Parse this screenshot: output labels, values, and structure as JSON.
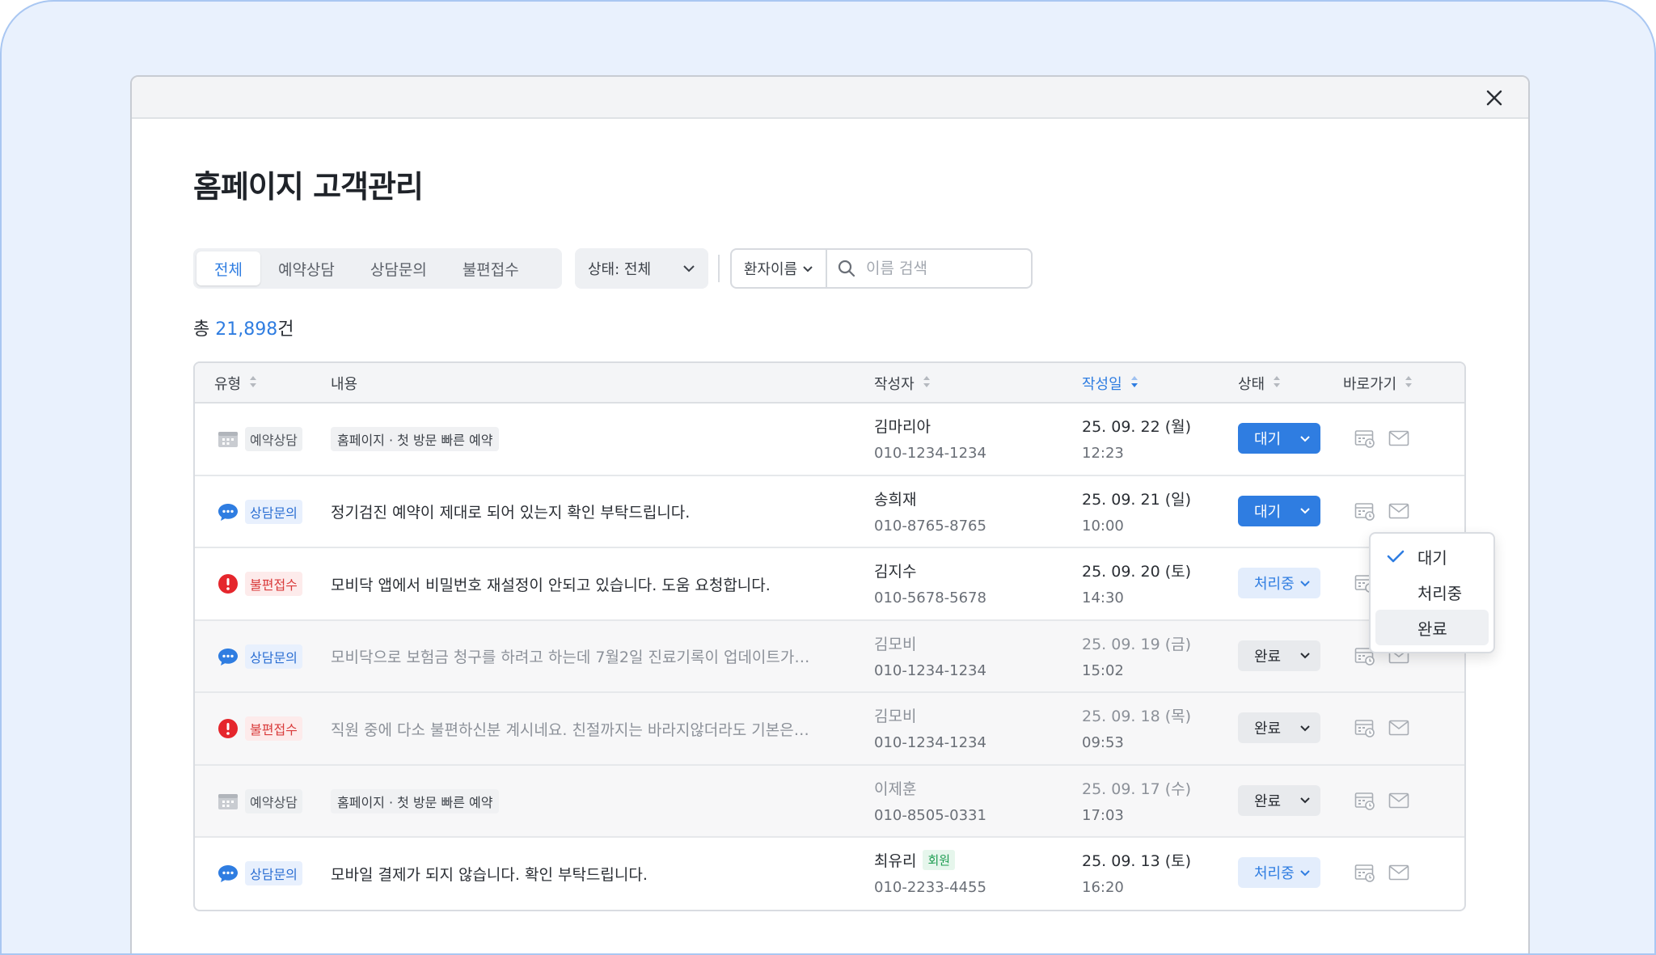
{
  "title": "홈페이지 고객관리",
  "tabs": [
    {
      "label": "전체",
      "active": true
    },
    {
      "label": "예약상담",
      "active": false
    },
    {
      "label": "상담문의",
      "active": false
    },
    {
      "label": "불편접수",
      "active": false
    }
  ],
  "status_filter": "상태: 전체",
  "search": {
    "type": "환자이름",
    "placeholder": "이름 검색"
  },
  "total": {
    "prefix": "총 ",
    "count": "21,898",
    "suffix": "건"
  },
  "columns": {
    "type": "유형",
    "content": "내용",
    "author": "작성자",
    "date": "작성일",
    "status": "상태",
    "shortcut": "바로가기"
  },
  "rows": [
    {
      "type": "예약상담",
      "type_kind": "reserve",
      "content": "홈페이지 · 첫 방문 빠른 예약",
      "content_tag": true,
      "name": "김마리아",
      "member": "",
      "phone": "010-1234-1234",
      "date": "25. 09. 22 (월)",
      "time": "12:23",
      "status": "대기",
      "status_kind": "wait",
      "dim": false
    },
    {
      "type": "상담문의",
      "type_kind": "consult",
      "content": "정기검진 예약이 제대로 되어 있는지 확인 부탁드립니다.",
      "content_tag": false,
      "name": "송희재",
      "member": "",
      "phone": "010-8765-8765",
      "date": "25. 09. 21 (일)",
      "time": "10:00",
      "status": "대기",
      "status_kind": "wait",
      "dim": false
    },
    {
      "type": "불편접수",
      "type_kind": "complain",
      "content": "모비닥 앱에서 비밀번호 재설정이 안되고 있습니다. 도움 요청합니다.",
      "content_tag": false,
      "name": "김지수",
      "member": "",
      "phone": "010-5678-5678",
      "date": "25. 09. 20 (토)",
      "time": "14:30",
      "status": "처리중",
      "status_kind": "proc",
      "dim": false
    },
    {
      "type": "상담문의",
      "type_kind": "consult",
      "content": "모비닥으로 보험금 청구를 하려고 하는데 7월2일 진료기록이 업데이트가…",
      "content_tag": false,
      "name": "김모비",
      "member": "",
      "phone": "010-1234-1234",
      "date": "25. 09. 19 (금)",
      "time": "15:02",
      "status": "완료",
      "status_kind": "done",
      "dim": true
    },
    {
      "type": "불편접수",
      "type_kind": "complain",
      "content": "직원 중에 다소 불편하신분 계시네요. 친절까지는 바라지않더라도 기본은…",
      "content_tag": false,
      "name": "김모비",
      "member": "",
      "phone": "010-1234-1234",
      "date": "25. 09. 18 (목)",
      "time": "09:53",
      "status": "완료",
      "status_kind": "done",
      "dim": true
    },
    {
      "type": "예약상담",
      "type_kind": "reserve",
      "content": "홈페이지 · 첫 방문 빠른 예약",
      "content_tag": true,
      "name": "이제훈",
      "member": "",
      "phone": "010-8505-0331",
      "date": "25. 09. 17 (수)",
      "time": "17:03",
      "status": "완료",
      "status_kind": "done",
      "dim": true
    },
    {
      "type": "상담문의",
      "type_kind": "consult",
      "content": "모바일 결제가 되지 않습니다. 확인 부탁드립니다.",
      "content_tag": false,
      "name": "최유리",
      "member": "회원",
      "phone": "010-2233-4455",
      "date": "25. 09. 13 (토)",
      "time": "16:20",
      "status": "처리중",
      "status_kind": "proc",
      "dim": false
    }
  ],
  "dropdown": {
    "items": [
      {
        "label": "대기",
        "checked": true,
        "hover": false
      },
      {
        "label": "처리중",
        "checked": false,
        "hover": false
      },
      {
        "label": "완료",
        "checked": false,
        "hover": true
      }
    ]
  },
  "colors": {
    "accent": "#2f7de1",
    "consult": "#2c6fd3",
    "complain": "#d93a3a",
    "background": "#e9f1fd"
  }
}
